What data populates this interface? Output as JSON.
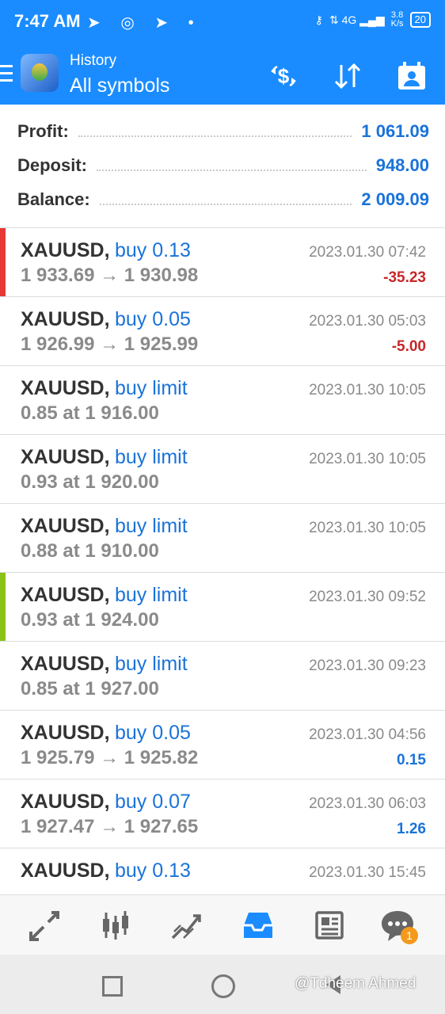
{
  "status": {
    "time": "7:47 AM",
    "net_speed": "3.8",
    "net_unit": "K/s",
    "signal": "4G",
    "battery": "20"
  },
  "header": {
    "subtitle": "History",
    "title": "All symbols"
  },
  "summary": [
    {
      "label": "Profit:",
      "value": "1 061.09"
    },
    {
      "label": "Deposit:",
      "value": "948.00"
    },
    {
      "label": "Balance:",
      "value": "2 009.09"
    }
  ],
  "trades": [
    {
      "symbol": "XAUUSD,",
      "action": "buy 0.13",
      "line2": "1 933.69 → 1 930.98",
      "date": "2023.01.30 07:42",
      "pl": "-35.23",
      "pl_color": "#c62828",
      "bar_color": "#e53935"
    },
    {
      "symbol": "XAUUSD,",
      "action": "buy 0.05",
      "line2": "1 926.99 → 1 925.99",
      "date": "2023.01.30 05:03",
      "pl": "-5.00",
      "pl_color": "#c62828",
      "bar_color": ""
    },
    {
      "symbol": "XAUUSD,",
      "action": "buy limit",
      "line2": "0.85 at 1 916.00",
      "date": "2023.01.30 10:05",
      "pl": "",
      "pl_color": "",
      "bar_color": ""
    },
    {
      "symbol": "XAUUSD,",
      "action": "buy limit",
      "line2": "0.93 at 1 920.00",
      "date": "2023.01.30 10:05",
      "pl": "",
      "pl_color": "",
      "bar_color": ""
    },
    {
      "symbol": "XAUUSD,",
      "action": "buy limit",
      "line2": "0.88 at 1 910.00",
      "date": "2023.01.30 10:05",
      "pl": "",
      "pl_color": "",
      "bar_color": ""
    },
    {
      "symbol": "XAUUSD,",
      "action": "buy limit",
      "line2": "0.93 at 1 924.00",
      "date": "2023.01.30 09:52",
      "pl": "",
      "pl_color": "",
      "bar_color": "#8bc31a"
    },
    {
      "symbol": "XAUUSD,",
      "action": "buy limit",
      "line2": "0.85 at 1 927.00",
      "date": "2023.01.30 09:23",
      "pl": "",
      "pl_color": "",
      "bar_color": ""
    },
    {
      "symbol": "XAUUSD,",
      "action": "buy 0.05",
      "line2": "1 925.79 → 1 925.82",
      "date": "2023.01.30 04:56",
      "pl": "0.15",
      "pl_color": "#1a73d9",
      "bar_color": ""
    },
    {
      "symbol": "XAUUSD,",
      "action": "buy 0.07",
      "line2": "1 927.47 → 1 927.65",
      "date": "2023.01.30 06:03",
      "pl": "1.26",
      "pl_color": "#1a73d9",
      "bar_color": ""
    },
    {
      "symbol": "XAUUSD,",
      "action": "buy 0.13",
      "line2": "",
      "date": "2023.01.30 15:45",
      "pl": "",
      "pl_color": "#1a73d9",
      "bar_color": ""
    }
  ],
  "bottom_nav": {
    "items": [
      "quotes-icon",
      "chart-icon",
      "trade-icon",
      "history-icon",
      "news-icon",
      "chat-icon"
    ],
    "active": "history-icon",
    "chat_badge": "1"
  },
  "watermark": "@Tdheem Ahmed",
  "colors": {
    "accent": "#1a8cff",
    "value_blue": "#1a73d9"
  }
}
